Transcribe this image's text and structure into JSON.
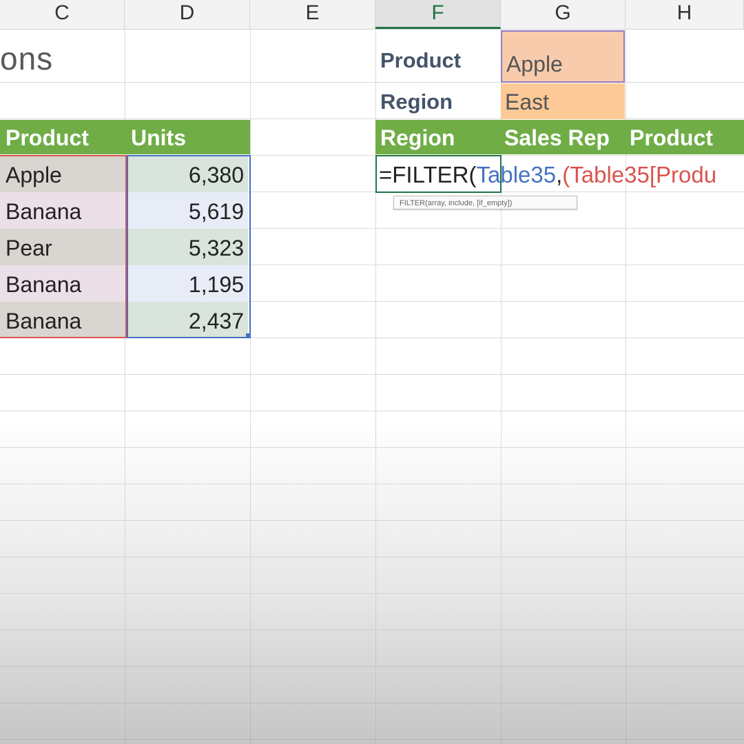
{
  "columns": [
    "C",
    "D",
    "E",
    "F",
    "G",
    "H"
  ],
  "active_column": "F",
  "title_fragment": "ons",
  "criteria": {
    "product_label": "Product",
    "product_value": "Apple",
    "region_label": "Region",
    "region_value": "East"
  },
  "source_table": {
    "headers": [
      "Product",
      "Units"
    ],
    "rows": [
      {
        "product": "Apple",
        "units": "6,380"
      },
      {
        "product": "Banana",
        "units": "5,619"
      },
      {
        "product": "Pear",
        "units": "5,323"
      },
      {
        "product": "Banana",
        "units": "1,195"
      },
      {
        "product": "Banana",
        "units": "2,437"
      }
    ]
  },
  "result_table": {
    "headers": [
      "Region",
      "Sales Rep",
      "Product"
    ]
  },
  "formula": {
    "part1": "=FILTER(",
    "part2": "Table35",
    "part3": ",",
    "part4": "(Table35[Produ"
  },
  "tooltip": "FILTER(array, include, [if_empty])",
  "colors": {
    "header_green": "#70ad47",
    "input_orange": "#f8cbad",
    "input_orange_2": "#fcc997",
    "ref_blue": "#4472c4",
    "ref_red": "#d9534f"
  }
}
